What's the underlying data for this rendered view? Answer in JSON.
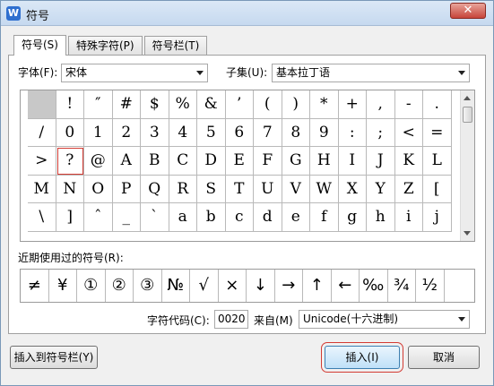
{
  "window": {
    "title": "符号",
    "app_icon_letter": "W",
    "close_glyph": "✕"
  },
  "tabs": [
    {
      "label": "符号(S)",
      "active": true
    },
    {
      "label": "特殊字符(P)",
      "active": false
    },
    {
      "label": "符号栏(T)",
      "active": false
    }
  ],
  "font": {
    "label": "字体(F):",
    "value": "宋体"
  },
  "subset": {
    "label": "子集(U):",
    "value": "基本拉丁语"
  },
  "symbol_grid": [
    [
      "",
      "!",
      "″",
      "#",
      "$",
      "%",
      "&",
      "’",
      "(",
      ")",
      "*",
      "+",
      ",",
      "-",
      "."
    ],
    [
      "/",
      "0",
      "1",
      "2",
      "3",
      "4",
      "5",
      "6",
      "7",
      "8",
      "9",
      ":",
      ";",
      "<",
      "="
    ],
    [
      ">",
      "?",
      "@",
      "A",
      "B",
      "C",
      "D",
      "E",
      "F",
      "G",
      "H",
      "I",
      "J",
      "K",
      "L"
    ],
    [
      "M",
      "N",
      "O",
      "P",
      "Q",
      "R",
      "S",
      "T",
      "U",
      "V",
      "W",
      "X",
      "Y",
      "Z",
      "["
    ],
    [
      "\\",
      "]",
      "ˆ",
      "_",
      "`",
      "a",
      "b",
      "c",
      "d",
      "e",
      "f",
      "g",
      "h",
      "i",
      "j"
    ]
  ],
  "selected_symbol": "?",
  "recent": {
    "label": "近期使用过的符号(R):",
    "items": [
      "≠",
      "¥",
      "①",
      "②",
      "③",
      "№",
      "√",
      "×",
      "↓",
      "→",
      "↑",
      "←",
      "‰",
      "¾",
      "½"
    ]
  },
  "char_code": {
    "label": "字符代码(C):",
    "value": "0020"
  },
  "from": {
    "label": "来自(M)",
    "value": "Unicode(十六进制)"
  },
  "buttons": {
    "insert_to_bar": "插入到符号栏(Y)",
    "insert": "插入(I)",
    "cancel": "取消"
  },
  "colors": {
    "highlight": "#d33b33",
    "title_bar": "#c6d9ef"
  }
}
